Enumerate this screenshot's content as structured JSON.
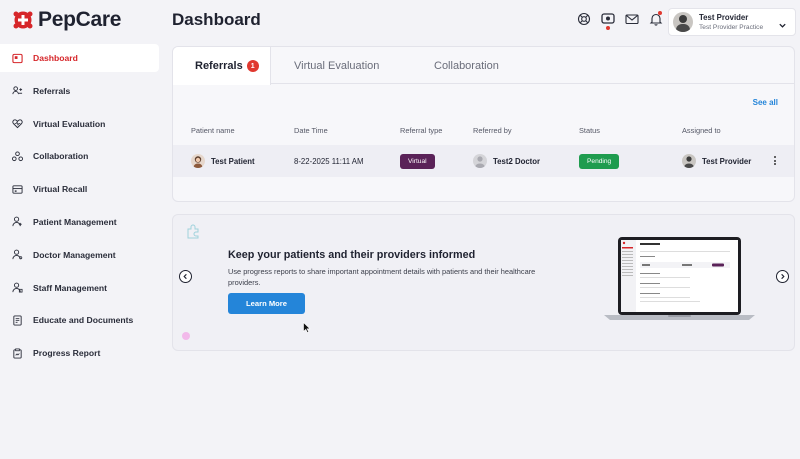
{
  "app": {
    "name": "PepCare",
    "brand_color": "#d6262a",
    "accent_color": "#2485d9"
  },
  "sidebar": {
    "items": [
      {
        "label": "Dashboard",
        "icon": "dashboard-icon",
        "active": true
      },
      {
        "label": "Referrals",
        "icon": "referrals-icon",
        "active": false
      },
      {
        "label": "Virtual Evaluation",
        "icon": "heart-icon",
        "active": false
      },
      {
        "label": "Collaboration",
        "icon": "collaboration-icon",
        "active": false
      },
      {
        "label": "Virtual Recall",
        "icon": "recall-icon",
        "active": false
      },
      {
        "label": "Patient Management",
        "icon": "patient-icon",
        "active": false
      },
      {
        "label": "Doctor Management",
        "icon": "doctor-icon",
        "active": false
      },
      {
        "label": "Staff Management",
        "icon": "staff-icon",
        "active": false
      },
      {
        "label": "Educate and Documents",
        "icon": "documents-icon",
        "active": false
      },
      {
        "label": "Progress Report",
        "icon": "report-icon",
        "active": false
      }
    ]
  },
  "header": {
    "title": "Dashboard",
    "icons": [
      "support-icon",
      "video-icon",
      "mail-icon",
      "bell-icon"
    ],
    "user_name": "Test Provider",
    "user_practice": "Test Provider Practice"
  },
  "referrals_card": {
    "tabs": [
      {
        "label": "Referrals",
        "badge": "1"
      },
      {
        "label": "Virtual Evaluation"
      },
      {
        "label": "Collaboration"
      }
    ],
    "see_all": "See all",
    "columns": [
      "Patient name",
      "Date Time",
      "Referral type",
      "Referred by",
      "Status",
      "Assigned to"
    ],
    "rows": [
      {
        "patient": "Test Patient",
        "datetime": "8-22-2025 11:11 AM",
        "type": "Virtual",
        "type_color": "#5a2258",
        "referred_by": "Test2 Doctor",
        "status": "Pending",
        "status_color": "#1f9c4f",
        "assigned_to": "Test Provider"
      }
    ]
  },
  "banner": {
    "title": "Keep your patients and their providers informed",
    "description": "Use progress reports to share important appointment details with patients and their healthcare providers.",
    "button_label": "Learn More"
  }
}
